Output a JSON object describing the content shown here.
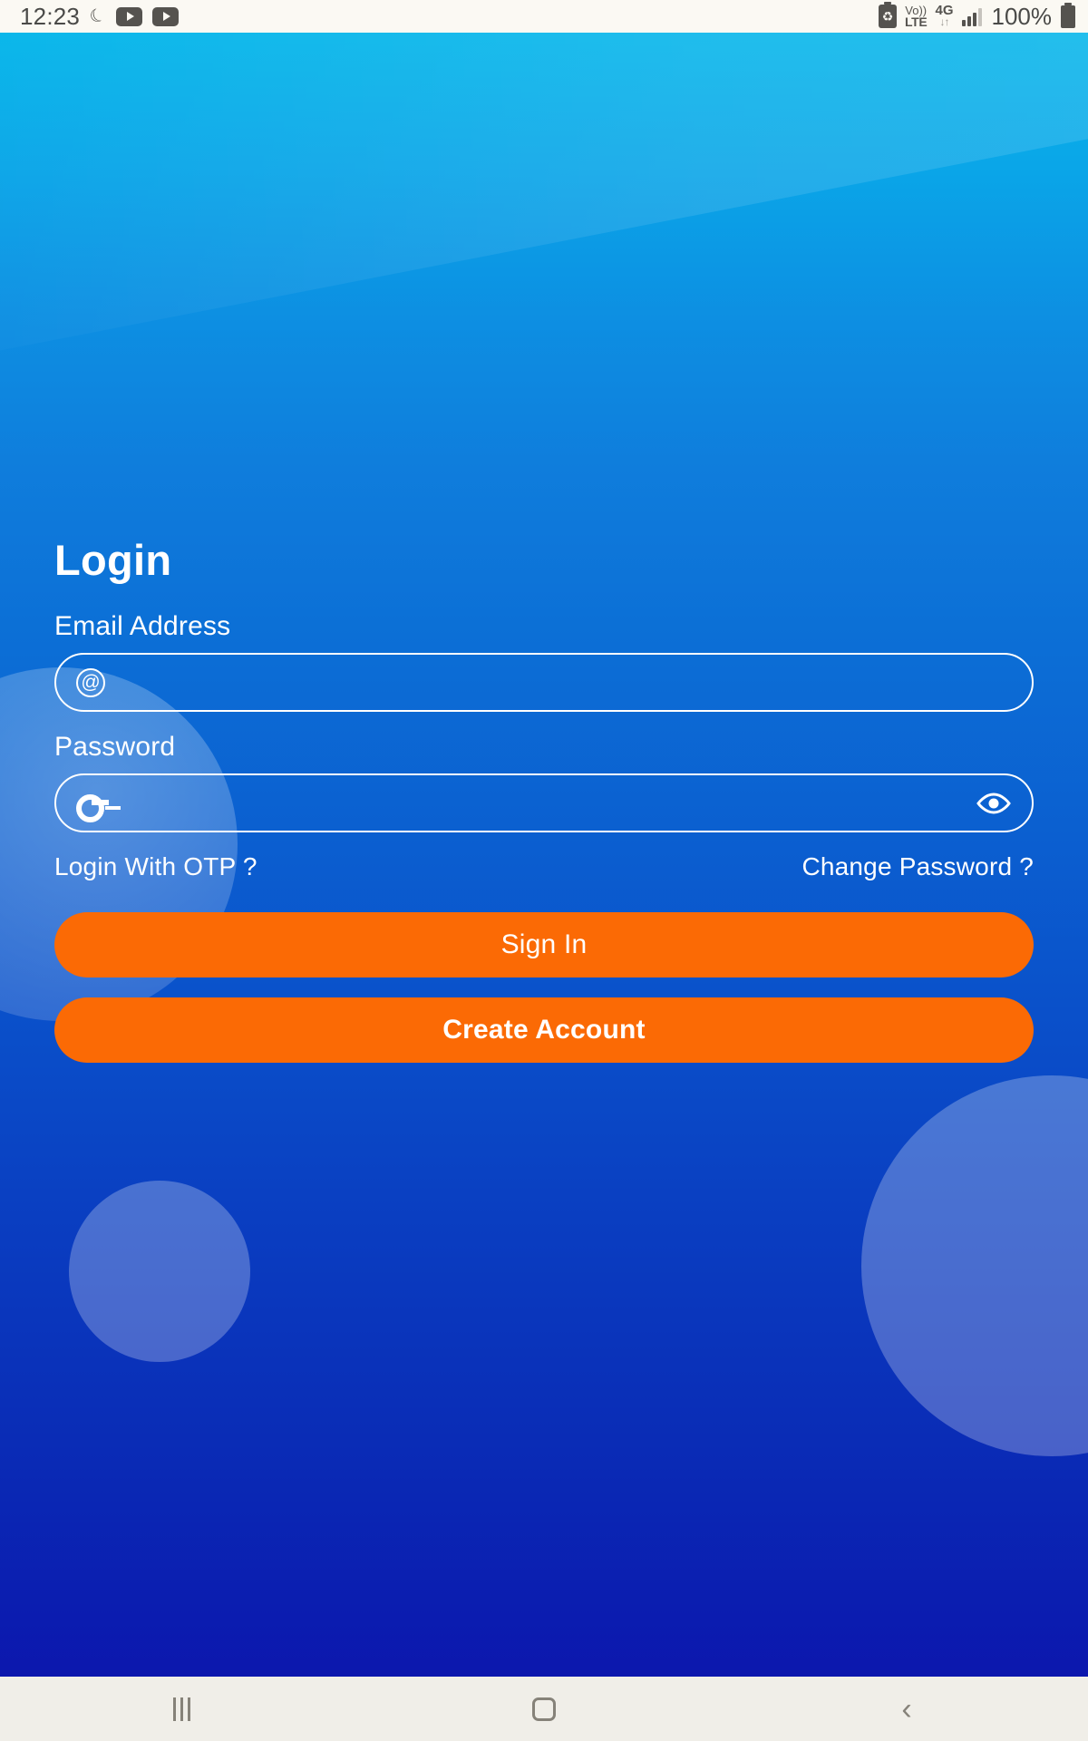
{
  "status_bar": {
    "time": "12:23",
    "moon_icon": "crescent-moon-icon",
    "app_badges": [
      "youtube-icon",
      "youtube-icon"
    ],
    "battery_saver_icon": "battery-recycle-icon",
    "volte_line1": "Vo))",
    "volte_line2": "LTE",
    "network_type": "4G",
    "data_arrows": "↓↑",
    "signal_icon": "signal-bars-icon",
    "battery_percent": "100%",
    "battery_icon": "battery-full-icon"
  },
  "screen": {
    "title": "Login"
  },
  "email": {
    "label": "Email Address",
    "value": "",
    "placeholder": "",
    "icon": "at-icon"
  },
  "password": {
    "label": "Password",
    "value": "",
    "placeholder": "",
    "icon": "key-icon",
    "toggle_icon": "eye-icon"
  },
  "links": {
    "otp": "Login With OTP ?",
    "change_password": "Change Password ?"
  },
  "actions": {
    "sign_in": "Sign In",
    "create_account": "Create Account"
  },
  "nav_bar": {
    "recents": "recents-icon",
    "home": "home-icon",
    "back": "back-icon"
  },
  "colors": {
    "accent_orange": "#fb6a05",
    "bg_top": "#06b6ea",
    "bg_bottom": "#0c14ad",
    "status_bar_bg": "#fbf9f3",
    "nav_bar_bg": "#f0eee8",
    "text_on_blue": "#ffffff"
  }
}
